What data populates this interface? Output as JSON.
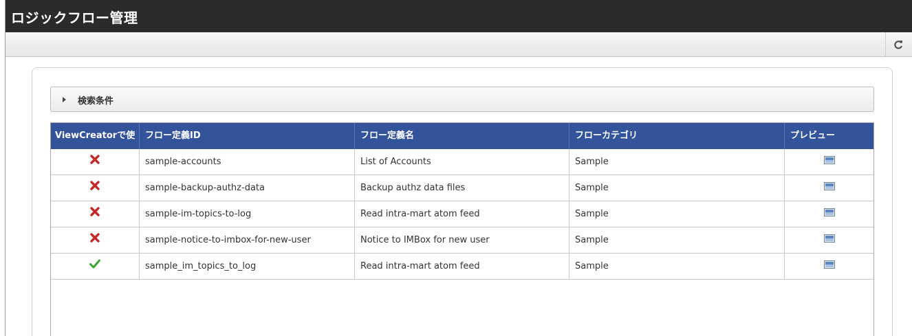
{
  "app": {
    "title": "ロジックフロー管理"
  },
  "toolbar": {
    "refresh_icon": "refresh-icon"
  },
  "search": {
    "label": "検索条件",
    "expanded": false
  },
  "table": {
    "columns": [
      "ViewCreatorで使",
      "フロー定義ID",
      "フロー定義名",
      "フローカテゴリ",
      "プレビュー"
    ],
    "rows": [
      {
        "status": "cross",
        "id": "sample-accounts",
        "name": "List of Accounts",
        "category": "Sample"
      },
      {
        "status": "cross",
        "id": "sample-backup-authz-data",
        "name": "Backup authz data files",
        "category": "Sample"
      },
      {
        "status": "cross",
        "id": "sample-im-topics-to-log",
        "name": "Read intra-mart atom feed",
        "category": "Sample"
      },
      {
        "status": "cross",
        "id": "sample-notice-to-imbox-for-new-user",
        "name": "Notice to IMBox for new user",
        "category": "Sample"
      },
      {
        "status": "check",
        "id": "sample_im_topics_to_log",
        "name": "Read intra-mart atom feed",
        "category": "Sample"
      }
    ]
  },
  "colors": {
    "title_bar": "#2b2b2b",
    "grid_header": "#33539b",
    "cross": "#c62828",
    "check": "#3aa333"
  }
}
